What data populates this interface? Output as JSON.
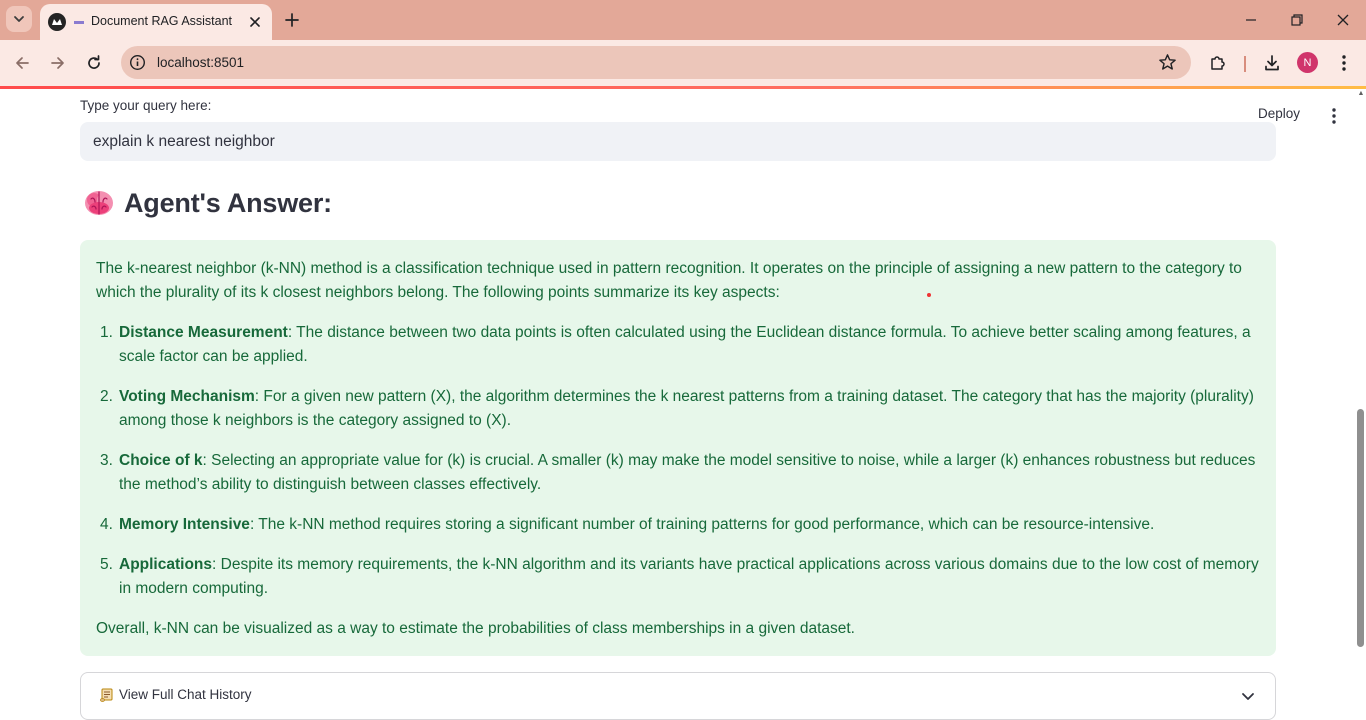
{
  "browser": {
    "tab_title": "Document RAG Assistant",
    "url": "localhost:8501",
    "avatar_initial": "N",
    "theme_color": "#e3a898"
  },
  "app": {
    "deploy_label": "Deploy",
    "query_label": "Type your query here:",
    "query_value": "explain k nearest neighbor",
    "answer_heading": "Agent's Answer:",
    "answer_heading_icon": "brain-icon",
    "answer": {
      "intro": "The k-nearest neighbor (k-NN) method is a classification technique used in pattern recognition. It operates on the principle of assigning a new pattern to the category to which the plurality of its k closest neighbors belong. The following points summarize its key aspects:",
      "items": [
        {
          "num": "1.",
          "title": "Distance Measurement",
          "text": ": The distance between two data points is often calculated using the Euclidean distance formula. To achieve better scaling among features, a scale factor can be applied."
        },
        {
          "num": "2.",
          "title": "Voting Mechanism",
          "text": ": For a given new pattern (X), the algorithm determines the k nearest patterns from a training dataset. The category that has the majority (plurality) among those k neighbors is the category assigned to (X)."
        },
        {
          "num": "3.",
          "title": "Choice of k",
          "text": ": Selecting an appropriate value for (k) is crucial. A smaller (k) may make the model sensitive to noise, while a larger (k) enhances robustness but reduces the method’s ability to distinguish between classes effectively."
        },
        {
          "num": "4.",
          "title": "Memory Intensive",
          "text": ": The k-NN method requires storing a significant number of training patterns for good performance, which can be resource-intensive."
        },
        {
          "num": "5.",
          "title": "Applications",
          "text": ": Despite its memory requirements, the k-NN algorithm and its variants have practical applications across various domains due to the low cost of memory in modern computing."
        }
      ],
      "outro": "Overall, k-NN can be visualized as a way to estimate the probabilities of class memberships in a given dataset."
    },
    "expander_label": "View Full Chat History",
    "expander_icon": "scroll-icon",
    "colors": {
      "answer_bg": "#e7f7ea",
      "answer_text": "#17693a",
      "input_bg": "#f0f2f6"
    }
  }
}
